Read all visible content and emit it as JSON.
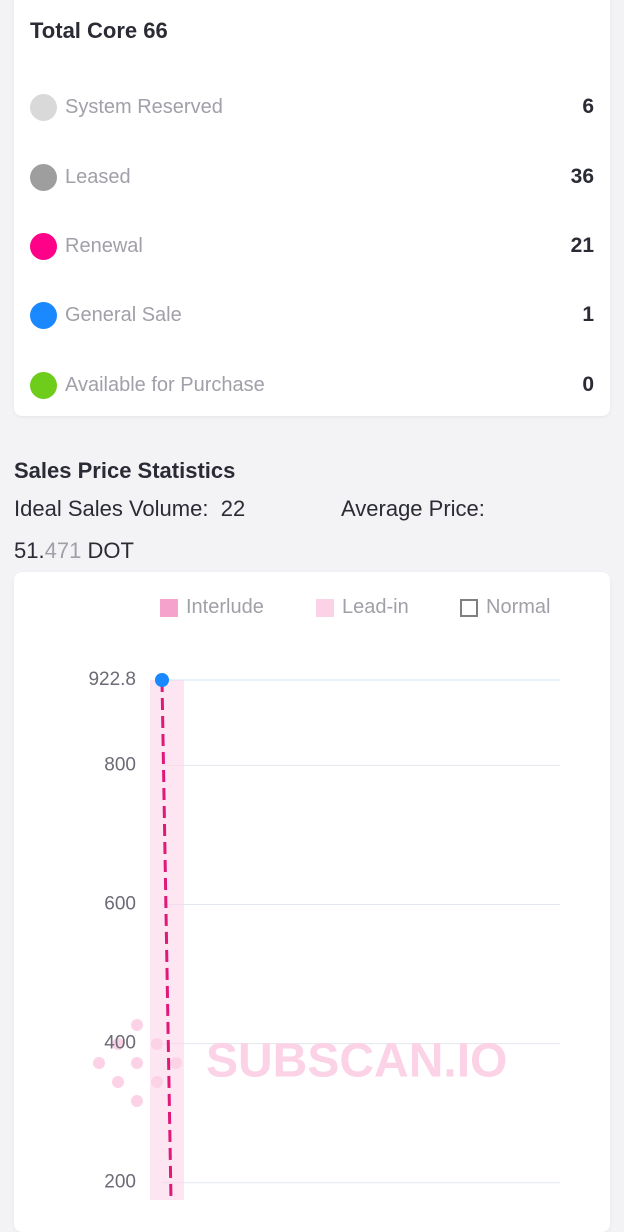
{
  "core": {
    "title": "Total Core 66",
    "items": [
      {
        "label": "System Reserved",
        "value": "6",
        "color": "#d9d9d9"
      },
      {
        "label": "Leased",
        "value": "36",
        "color": "#9e9e9e"
      },
      {
        "label": "Renewal",
        "value": "21",
        "color": "#ff0088"
      },
      {
        "label": "General Sale",
        "value": "1",
        "color": "#1a88ff"
      },
      {
        "label": "Available for Purchase",
        "value": "0",
        "color": "#6ecc1a"
      }
    ]
  },
  "sales": {
    "title": "Sales Price Statistics",
    "ideal_label": "Ideal Sales Volume:",
    "ideal_value": "22",
    "avg_label": "Average Price:",
    "avg_int": "51.",
    "avg_dec": "471",
    "avg_unit": "DOT"
  },
  "legend": [
    {
      "label": "Interlude",
      "color": "#f5a3cc",
      "style": "filled"
    },
    {
      "label": "Lead-in",
      "color": "#fbd2e6",
      "style": "filled"
    },
    {
      "label": "Normal",
      "color": "#808080",
      "style": "outline"
    }
  ],
  "watermark": "SUBSCAN.IO",
  "chart_data": {
    "type": "line",
    "ylim": [
      0,
      922.8
    ],
    "y_ticks": [
      "922.8",
      "800",
      "600",
      "400",
      "200"
    ],
    "y_tick_values": [
      922.8,
      800,
      600,
      400,
      200
    ],
    "series": [
      {
        "x": [
          0
        ],
        "values": [
          922.8
        ],
        "point_color": "#1a88ff",
        "line_color": "#e0187a"
      }
    ],
    "grid": true,
    "legend_position": "top-right"
  }
}
